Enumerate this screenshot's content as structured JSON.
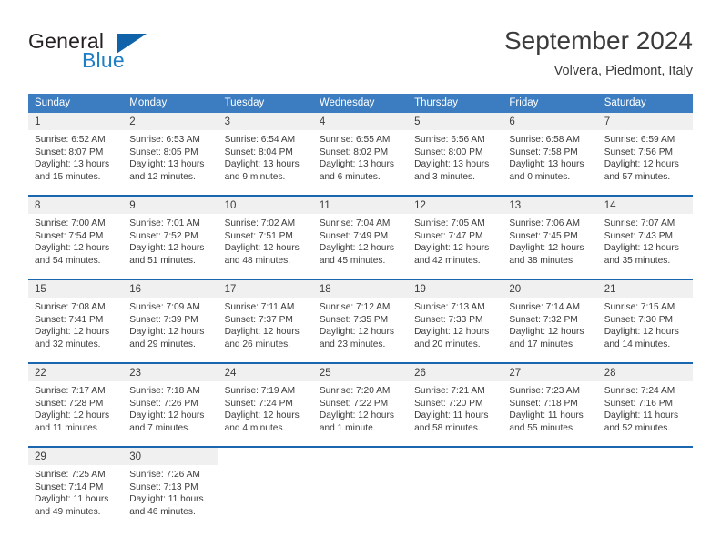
{
  "brand": {
    "name_part1": "General",
    "name_part2": "Blue",
    "logo_icon": "triangle-logo-icon",
    "accent_color": "#1063a8"
  },
  "header": {
    "title": "September 2024",
    "subtitle": "Volvera, Piedmont, Italy"
  },
  "theme": {
    "header_row_bg": "#3b7dc0",
    "week_border": "#1a67b0",
    "day_band_bg": "#f0f0f0",
    "text": "#3b3b3b"
  },
  "calendar": {
    "weekdays": [
      "Sunday",
      "Monday",
      "Tuesday",
      "Wednesday",
      "Thursday",
      "Friday",
      "Saturday"
    ],
    "weeks": [
      [
        {
          "day": "1",
          "sunrise": "Sunrise: 6:52 AM",
          "sunset": "Sunset: 8:07 PM",
          "daylight1": "Daylight: 13 hours",
          "daylight2": "and 15 minutes."
        },
        {
          "day": "2",
          "sunrise": "Sunrise: 6:53 AM",
          "sunset": "Sunset: 8:05 PM",
          "daylight1": "Daylight: 13 hours",
          "daylight2": "and 12 minutes."
        },
        {
          "day": "3",
          "sunrise": "Sunrise: 6:54 AM",
          "sunset": "Sunset: 8:04 PM",
          "daylight1": "Daylight: 13 hours",
          "daylight2": "and 9 minutes."
        },
        {
          "day": "4",
          "sunrise": "Sunrise: 6:55 AM",
          "sunset": "Sunset: 8:02 PM",
          "daylight1": "Daylight: 13 hours",
          "daylight2": "and 6 minutes."
        },
        {
          "day": "5",
          "sunrise": "Sunrise: 6:56 AM",
          "sunset": "Sunset: 8:00 PM",
          "daylight1": "Daylight: 13 hours",
          "daylight2": "and 3 minutes."
        },
        {
          "day": "6",
          "sunrise": "Sunrise: 6:58 AM",
          "sunset": "Sunset: 7:58 PM",
          "daylight1": "Daylight: 13 hours",
          "daylight2": "and 0 minutes."
        },
        {
          "day": "7",
          "sunrise": "Sunrise: 6:59 AM",
          "sunset": "Sunset: 7:56 PM",
          "daylight1": "Daylight: 12 hours",
          "daylight2": "and 57 minutes."
        }
      ],
      [
        {
          "day": "8",
          "sunrise": "Sunrise: 7:00 AM",
          "sunset": "Sunset: 7:54 PM",
          "daylight1": "Daylight: 12 hours",
          "daylight2": "and 54 minutes."
        },
        {
          "day": "9",
          "sunrise": "Sunrise: 7:01 AM",
          "sunset": "Sunset: 7:52 PM",
          "daylight1": "Daylight: 12 hours",
          "daylight2": "and 51 minutes."
        },
        {
          "day": "10",
          "sunrise": "Sunrise: 7:02 AM",
          "sunset": "Sunset: 7:51 PM",
          "daylight1": "Daylight: 12 hours",
          "daylight2": "and 48 minutes."
        },
        {
          "day": "11",
          "sunrise": "Sunrise: 7:04 AM",
          "sunset": "Sunset: 7:49 PM",
          "daylight1": "Daylight: 12 hours",
          "daylight2": "and 45 minutes."
        },
        {
          "day": "12",
          "sunrise": "Sunrise: 7:05 AM",
          "sunset": "Sunset: 7:47 PM",
          "daylight1": "Daylight: 12 hours",
          "daylight2": "and 42 minutes."
        },
        {
          "day": "13",
          "sunrise": "Sunrise: 7:06 AM",
          "sunset": "Sunset: 7:45 PM",
          "daylight1": "Daylight: 12 hours",
          "daylight2": "and 38 minutes."
        },
        {
          "day": "14",
          "sunrise": "Sunrise: 7:07 AM",
          "sunset": "Sunset: 7:43 PM",
          "daylight1": "Daylight: 12 hours",
          "daylight2": "and 35 minutes."
        }
      ],
      [
        {
          "day": "15",
          "sunrise": "Sunrise: 7:08 AM",
          "sunset": "Sunset: 7:41 PM",
          "daylight1": "Daylight: 12 hours",
          "daylight2": "and 32 minutes."
        },
        {
          "day": "16",
          "sunrise": "Sunrise: 7:09 AM",
          "sunset": "Sunset: 7:39 PM",
          "daylight1": "Daylight: 12 hours",
          "daylight2": "and 29 minutes."
        },
        {
          "day": "17",
          "sunrise": "Sunrise: 7:11 AM",
          "sunset": "Sunset: 7:37 PM",
          "daylight1": "Daylight: 12 hours",
          "daylight2": "and 26 minutes."
        },
        {
          "day": "18",
          "sunrise": "Sunrise: 7:12 AM",
          "sunset": "Sunset: 7:35 PM",
          "daylight1": "Daylight: 12 hours",
          "daylight2": "and 23 minutes."
        },
        {
          "day": "19",
          "sunrise": "Sunrise: 7:13 AM",
          "sunset": "Sunset: 7:33 PM",
          "daylight1": "Daylight: 12 hours",
          "daylight2": "and 20 minutes."
        },
        {
          "day": "20",
          "sunrise": "Sunrise: 7:14 AM",
          "sunset": "Sunset: 7:32 PM",
          "daylight1": "Daylight: 12 hours",
          "daylight2": "and 17 minutes."
        },
        {
          "day": "21",
          "sunrise": "Sunrise: 7:15 AM",
          "sunset": "Sunset: 7:30 PM",
          "daylight1": "Daylight: 12 hours",
          "daylight2": "and 14 minutes."
        }
      ],
      [
        {
          "day": "22",
          "sunrise": "Sunrise: 7:17 AM",
          "sunset": "Sunset: 7:28 PM",
          "daylight1": "Daylight: 12 hours",
          "daylight2": "and 11 minutes."
        },
        {
          "day": "23",
          "sunrise": "Sunrise: 7:18 AM",
          "sunset": "Sunset: 7:26 PM",
          "daylight1": "Daylight: 12 hours",
          "daylight2": "and 7 minutes."
        },
        {
          "day": "24",
          "sunrise": "Sunrise: 7:19 AM",
          "sunset": "Sunset: 7:24 PM",
          "daylight1": "Daylight: 12 hours",
          "daylight2": "and 4 minutes."
        },
        {
          "day": "25",
          "sunrise": "Sunrise: 7:20 AM",
          "sunset": "Sunset: 7:22 PM",
          "daylight1": "Daylight: 12 hours",
          "daylight2": "and 1 minute."
        },
        {
          "day": "26",
          "sunrise": "Sunrise: 7:21 AM",
          "sunset": "Sunset: 7:20 PM",
          "daylight1": "Daylight: 11 hours",
          "daylight2": "and 58 minutes."
        },
        {
          "day": "27",
          "sunrise": "Sunrise: 7:23 AM",
          "sunset": "Sunset: 7:18 PM",
          "daylight1": "Daylight: 11 hours",
          "daylight2": "and 55 minutes."
        },
        {
          "day": "28",
          "sunrise": "Sunrise: 7:24 AM",
          "sunset": "Sunset: 7:16 PM",
          "daylight1": "Daylight: 11 hours",
          "daylight2": "and 52 minutes."
        }
      ],
      [
        {
          "day": "29",
          "sunrise": "Sunrise: 7:25 AM",
          "sunset": "Sunset: 7:14 PM",
          "daylight1": "Daylight: 11 hours",
          "daylight2": "and 49 minutes."
        },
        {
          "day": "30",
          "sunrise": "Sunrise: 7:26 AM",
          "sunset": "Sunset: 7:13 PM",
          "daylight1": "Daylight: 11 hours",
          "daylight2": "and 46 minutes."
        },
        {
          "day": "",
          "sunrise": "",
          "sunset": "",
          "daylight1": "",
          "daylight2": ""
        },
        {
          "day": "",
          "sunrise": "",
          "sunset": "",
          "daylight1": "",
          "daylight2": ""
        },
        {
          "day": "",
          "sunrise": "",
          "sunset": "",
          "daylight1": "",
          "daylight2": ""
        },
        {
          "day": "",
          "sunrise": "",
          "sunset": "",
          "daylight1": "",
          "daylight2": ""
        },
        {
          "day": "",
          "sunrise": "",
          "sunset": "",
          "daylight1": "",
          "daylight2": ""
        }
      ]
    ]
  }
}
